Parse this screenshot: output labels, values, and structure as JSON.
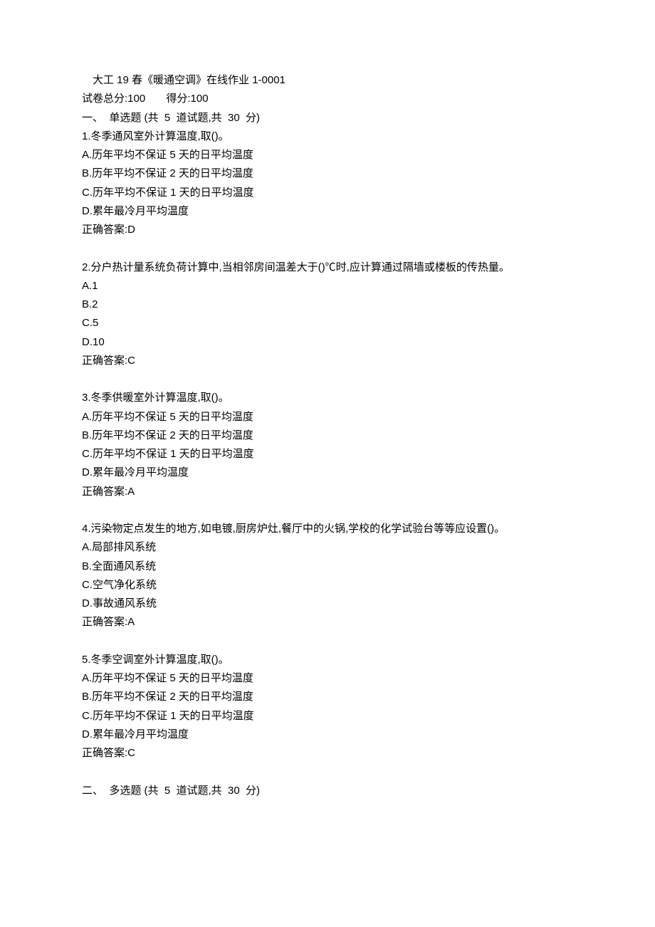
{
  "header": {
    "title": "大工 19 春《暖通空调》在线作业 1-0001",
    "score_line": "试卷总分:100       得分:100"
  },
  "section1": {
    "heading": "一、  单选题 (共  5  道试题,共  30  分)",
    "questions": [
      {
        "stem": "1.冬季通风室外计算温度,取()。",
        "options": [
          "A.历年平均不保证 5 天的日平均温度",
          "B.历年平均不保证 2 天的日平均温度",
          "C.历年平均不保证 1 天的日平均温度",
          "D.累年最冷月平均温度"
        ],
        "answer": "正确答案:D"
      },
      {
        "stem": "2.分户热计量系统负荷计算中,当相邻房间温差大于()℃时,应计算通过隔墙或楼板的传热量。",
        "options": [
          "A.1",
          "B.2",
          "C.5",
          "D.10"
        ],
        "answer": "正确答案:C"
      },
      {
        "stem": "3.冬季供暖室外计算温度,取()。",
        "options": [
          "A.历年平均不保证 5 天的日平均温度",
          "B.历年平均不保证 2 天的日平均温度",
          "C.历年平均不保证 1 天的日平均温度",
          "D.累年最冷月平均温度"
        ],
        "answer": "正确答案:A"
      },
      {
        "stem": "4.污染物定点发生的地方,如电镀,厨房炉灶,餐厅中的火锅,学校的化学试验台等等应设置()。",
        "options": [
          "A.局部排风系统",
          "B.全面通风系统",
          "C.空气净化系统",
          "D.事故通风系统"
        ],
        "answer": "正确答案:A"
      },
      {
        "stem": "5.冬季空调室外计算温度,取()。",
        "options": [
          "A.历年平均不保证 5 天的日平均温度",
          "B.历年平均不保证 2 天的日平均温度",
          "C.历年平均不保证 1 天的日平均温度",
          "D.累年最冷月平均温度"
        ],
        "answer": "正确答案:C"
      }
    ]
  },
  "section2": {
    "heading": "二、  多选题 (共  5  道试题,共  30  分)"
  }
}
